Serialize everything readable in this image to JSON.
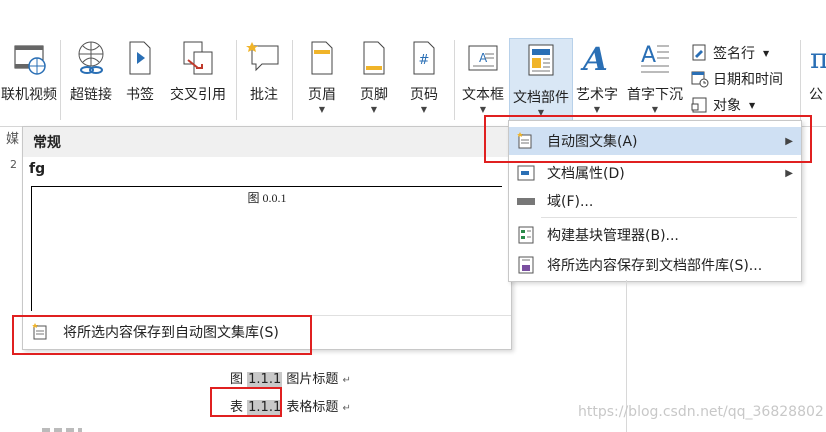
{
  "ribbon": {
    "online_video": "联机视频",
    "hyperlink": "超链接",
    "bookmark": "书签",
    "cross_reference": "交叉引用",
    "comment": "批注",
    "header": "页眉",
    "footer": "页脚",
    "page_number": "页码",
    "text_box": "文本框",
    "quick_parts": "文档部件",
    "wordart": "艺术字",
    "drop_cap": "首字下沉",
    "signature_line": "签名行",
    "date_time": "日期和时间",
    "object": "对象",
    "equation_partial": "公",
    "media_group_partial": "媒"
  },
  "gallery": {
    "header": "常规",
    "entry_name": "fg",
    "preview_caption": "图 0.0.1",
    "save_selection": "将所选内容保存到自动图文集库(S)"
  },
  "menu": {
    "items": [
      {
        "label": "自动图文集(A)",
        "has_submenu": true
      },
      {
        "label": "文档属性(D)",
        "has_submenu": true
      },
      {
        "label": "域(F)...",
        "has_submenu": false
      },
      {
        "label": "构建基块管理器(B)...",
        "has_submenu": false
      },
      {
        "label": "将所选内容保存到文档部件库(S)...",
        "has_submenu": false
      }
    ]
  },
  "document": {
    "figure_prefix": "图",
    "figure_number": "1.1.1",
    "figure_title": "图片标题",
    "table_prefix": "表",
    "table_number": "1.1.1",
    "table_title": "表格标题",
    "paragraph_mark": "↵",
    "ruler_number": "2"
  },
  "watermark": "https://blog.csdn.net/qq_36828802",
  "colors": {
    "highlight_red": "#e02020",
    "selected_blue": "#d9e7f5"
  }
}
